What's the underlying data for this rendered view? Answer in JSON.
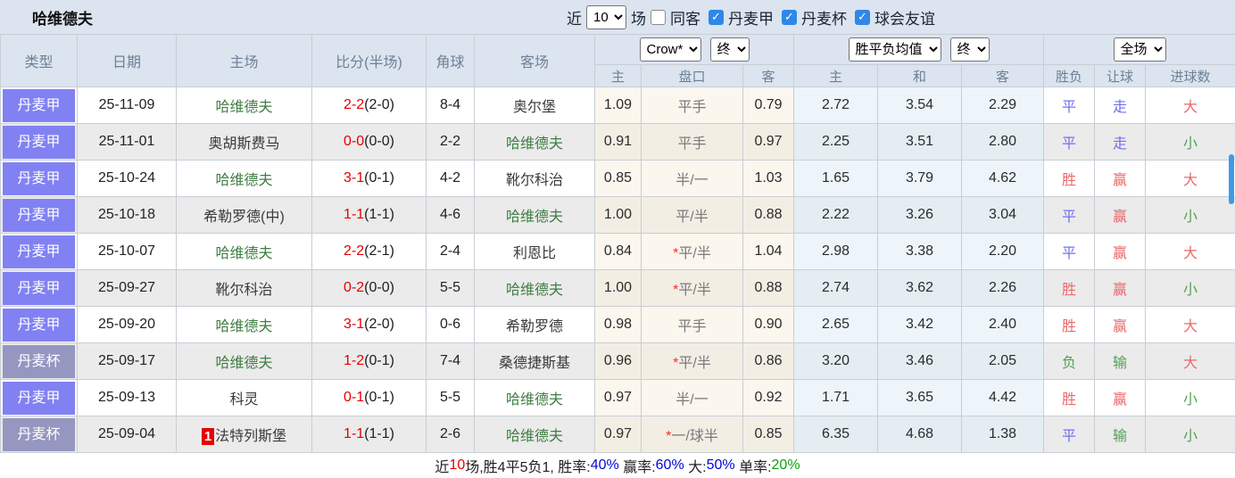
{
  "header": {
    "title": "哈维德夫",
    "recent": {
      "label_before": "近",
      "value": "10",
      "label_after": "场"
    },
    "same_away": {
      "label": "同客",
      "state": "unchecked"
    },
    "leagues": [
      {
        "label": "丹麦甲",
        "state": "checked"
      },
      {
        "label": "丹麦杯",
        "state": "checked"
      },
      {
        "label": "球会友谊",
        "state": "checked"
      }
    ]
  },
  "table": {
    "headers": {
      "type": "类型",
      "date": "日期",
      "home": "主场",
      "score": "比分(半场)",
      "corner": "角球",
      "away": "客场",
      "sub_home": "主",
      "sub_handicap": "盘口",
      "sub_away": "客",
      "sub_win": "主",
      "sub_draw": "和",
      "sub_lose": "客",
      "sub_result": "胜负",
      "sub_handicap_result": "让球",
      "sub_goals": "进球数"
    },
    "selects": {
      "company": "Crow*",
      "stage1": "终",
      "europe": "胜平负均值",
      "stage2": "终",
      "scope": "全场"
    },
    "rows": [
      {
        "league": "丹麦甲",
        "league_kind": "jia",
        "date": "25-11-09",
        "home_badge": "",
        "home": "哈维德夫",
        "home_tone": "green",
        "score": "2-2",
        "half": "(2-0)",
        "corner": "8-4",
        "away": "奥尔堡",
        "away_tone": "dark",
        "odds_home": "1.09",
        "handicap_star": "",
        "handicap": "平手",
        "odds_away": "0.79",
        "win": "2.72",
        "draw": "3.54",
        "lose": "2.29",
        "result": "平",
        "result_color": "blue",
        "handicap_result": "走",
        "handicap_result_color": "blue",
        "goals": "大",
        "goals_color": "red"
      },
      {
        "league": "丹麦甲",
        "league_kind": "jia",
        "date": "25-11-01",
        "home_badge": "",
        "home": "奥胡斯费马",
        "home_tone": "dark",
        "score": "0-0",
        "half": "(0-0)",
        "corner": "2-2",
        "away": "哈维德夫",
        "away_tone": "green",
        "odds_home": "0.91",
        "handicap_star": "",
        "handicap": "平手",
        "odds_away": "0.97",
        "win": "2.25",
        "draw": "3.51",
        "lose": "2.80",
        "result": "平",
        "result_color": "blue",
        "handicap_result": "走",
        "handicap_result_color": "blue",
        "goals": "小",
        "goals_color": "green"
      },
      {
        "league": "丹麦甲",
        "league_kind": "jia",
        "date": "25-10-24",
        "home_badge": "",
        "home": "哈维德夫",
        "home_tone": "green",
        "score": "3-1",
        "half": "(0-1)",
        "corner": "4-2",
        "away": "靴尔科治",
        "away_tone": "dark",
        "odds_home": "0.85",
        "handicap_star": "",
        "handicap": "半/一",
        "odds_away": "1.03",
        "win": "1.65",
        "draw": "3.79",
        "lose": "4.62",
        "result": "胜",
        "result_color": "red",
        "handicap_result": "赢",
        "handicap_result_color": "red",
        "goals": "大",
        "goals_color": "red"
      },
      {
        "league": "丹麦甲",
        "league_kind": "jia",
        "date": "25-10-18",
        "home_badge": "",
        "home": "希勒罗德(中)",
        "home_tone": "dark",
        "score": "1-1",
        "half": "(1-1)",
        "corner": "4-6",
        "away": "哈维德夫",
        "away_tone": "green",
        "odds_home": "1.00",
        "handicap_star": "",
        "handicap": "平/半",
        "odds_away": "0.88",
        "win": "2.22",
        "draw": "3.26",
        "lose": "3.04",
        "result": "平",
        "result_color": "blue",
        "handicap_result": "赢",
        "handicap_result_color": "red",
        "goals": "小",
        "goals_color": "green"
      },
      {
        "league": "丹麦甲",
        "league_kind": "jia",
        "date": "25-10-07",
        "home_badge": "",
        "home": "哈维德夫",
        "home_tone": "green",
        "score": "2-2",
        "half": "(2-1)",
        "corner": "2-4",
        "away": "利恩比",
        "away_tone": "dark",
        "odds_home": "0.84",
        "handicap_star": "*",
        "handicap": "平/半",
        "odds_away": "1.04",
        "win": "2.98",
        "draw": "3.38",
        "lose": "2.20",
        "result": "平",
        "result_color": "blue",
        "handicap_result": "赢",
        "handicap_result_color": "red",
        "goals": "大",
        "goals_color": "red"
      },
      {
        "league": "丹麦甲",
        "league_kind": "jia",
        "date": "25-09-27",
        "home_badge": "",
        "home": "靴尔科治",
        "home_tone": "dark",
        "score": "0-2",
        "half": "(0-0)",
        "corner": "5-5",
        "away": "哈维德夫",
        "away_tone": "green",
        "odds_home": "1.00",
        "handicap_star": "*",
        "handicap": "平/半",
        "odds_away": "0.88",
        "win": "2.74",
        "draw": "3.62",
        "lose": "2.26",
        "result": "胜",
        "result_color": "red",
        "handicap_result": "赢",
        "handicap_result_color": "red",
        "goals": "小",
        "goals_color": "green"
      },
      {
        "league": "丹麦甲",
        "league_kind": "jia",
        "date": "25-09-20",
        "home_badge": "",
        "home": "哈维德夫",
        "home_tone": "green",
        "score": "3-1",
        "half": "(2-0)",
        "corner": "0-6",
        "away": "希勒罗德",
        "away_tone": "dark",
        "odds_home": "0.98",
        "handicap_star": "",
        "handicap": "平手",
        "odds_away": "0.90",
        "win": "2.65",
        "draw": "3.42",
        "lose": "2.40",
        "result": "胜",
        "result_color": "red",
        "handicap_result": "赢",
        "handicap_result_color": "red",
        "goals": "大",
        "goals_color": "red"
      },
      {
        "league": "丹麦杯",
        "league_kind": "bei",
        "date": "25-09-17",
        "home_badge": "",
        "home": "哈维德夫",
        "home_tone": "green",
        "score": "1-2",
        "half": "(0-1)",
        "corner": "7-4",
        "away": "桑德捷斯基",
        "away_tone": "dark",
        "odds_home": "0.96",
        "handicap_star": "*",
        "handicap": "平/半",
        "odds_away": "0.86",
        "win": "3.20",
        "draw": "3.46",
        "lose": "2.05",
        "result": "负",
        "result_color": "green",
        "handicap_result": "输",
        "handicap_result_color": "green",
        "goals": "大",
        "goals_color": "red"
      },
      {
        "league": "丹麦甲",
        "league_kind": "jia",
        "date": "25-09-13",
        "home_badge": "",
        "home": "科灵",
        "home_tone": "dark",
        "score": "0-1",
        "half": "(0-1)",
        "corner": "5-5",
        "away": "哈维德夫",
        "away_tone": "green",
        "odds_home": "0.97",
        "handicap_star": "",
        "handicap": "半/一",
        "odds_away": "0.92",
        "win": "1.71",
        "draw": "3.65",
        "lose": "4.42",
        "result": "胜",
        "result_color": "red",
        "handicap_result": "赢",
        "handicap_result_color": "red",
        "goals": "小",
        "goals_color": "green"
      },
      {
        "league": "丹麦杯",
        "league_kind": "bei",
        "date": "25-09-04",
        "home_badge": "1",
        "home": "法特列斯堡",
        "home_tone": "dark",
        "score": "1-1",
        "half": "(1-1)",
        "corner": "2-6",
        "away": "哈维德夫",
        "away_tone": "green",
        "odds_home": "0.97",
        "handicap_star": "*",
        "handicap": "一/球半",
        "odds_away": "0.85",
        "win": "6.35",
        "draw": "4.68",
        "lose": "1.38",
        "result": "平",
        "result_color": "blue",
        "handicap_result": "输",
        "handicap_result_color": "green",
        "goals": "小",
        "goals_color": "green"
      }
    ]
  },
  "footer": {
    "parts": [
      {
        "text": "近",
        "color": "dark"
      },
      {
        "text": "10",
        "color": "red"
      },
      {
        "text": "场,胜4平5负1, 胜率:",
        "color": "dark"
      },
      {
        "text": "40%",
        "color": "blue"
      },
      {
        "text": " 赢率:",
        "color": "dark"
      },
      {
        "text": "60%",
        "color": "blue"
      },
      {
        "text": " 大:",
        "color": "dark"
      },
      {
        "text": "50%",
        "color": "blue"
      },
      {
        "text": " 单率:",
        "color": "dark"
      },
      {
        "text": "20%",
        "color": "green"
      }
    ]
  },
  "colors": {
    "header_bg": "#dbe4ef",
    "league_badge": "#8181f3",
    "cup_badge": "#9697c0",
    "win_red": "#e9696b",
    "draw_blue": "#7170f0",
    "lose_green": "#55a055",
    "team_green": "#3f7d42",
    "score_red": "#e60000",
    "checkbox_blue": "#2f87e8"
  }
}
